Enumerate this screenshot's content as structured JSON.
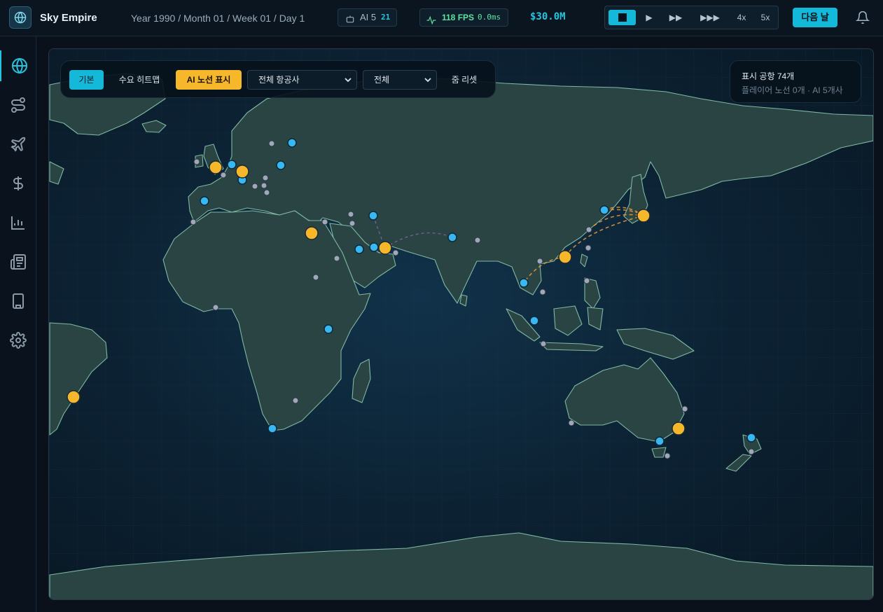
{
  "app": {
    "title": "Sky Empire"
  },
  "header": {
    "date": "Year 1990 / Month 01 / Week 01 / Day 1",
    "ai_label": "AI 5",
    "ai_count": "21",
    "fps": "118 FPS",
    "frame_ms": "0.0ms",
    "money": "$30.0M",
    "speed_buttons": [
      "■",
      "▶",
      "▶▶",
      "▶▶▶",
      "4x",
      "5x"
    ],
    "next_day": "다음 날"
  },
  "sidebar": {
    "items": [
      "globe-icon",
      "routes-icon",
      "plane-icon",
      "dollar-icon",
      "chart-icon",
      "news-icon",
      "building-icon",
      "gear-icon"
    ],
    "active": "globe-icon"
  },
  "map_controls": {
    "basic": "기본",
    "heatmap": "수요 히트맵",
    "ai_routes": "AI 노선 표시",
    "airline_filter": "전체 항공사",
    "scope_filter": "전체",
    "zoom_reset": "줌 리셋"
  },
  "info_panel": {
    "airports": "표시 공항 74개",
    "summary": "플레이어 노선 0개 · AI 5개사"
  },
  "colors": {
    "accent": "#14b8d9",
    "hub": "#f6b82a",
    "airport": "#3ab6f0",
    "minor_airport": "#a0a8b8",
    "ai_route": "#e89a3a"
  }
}
